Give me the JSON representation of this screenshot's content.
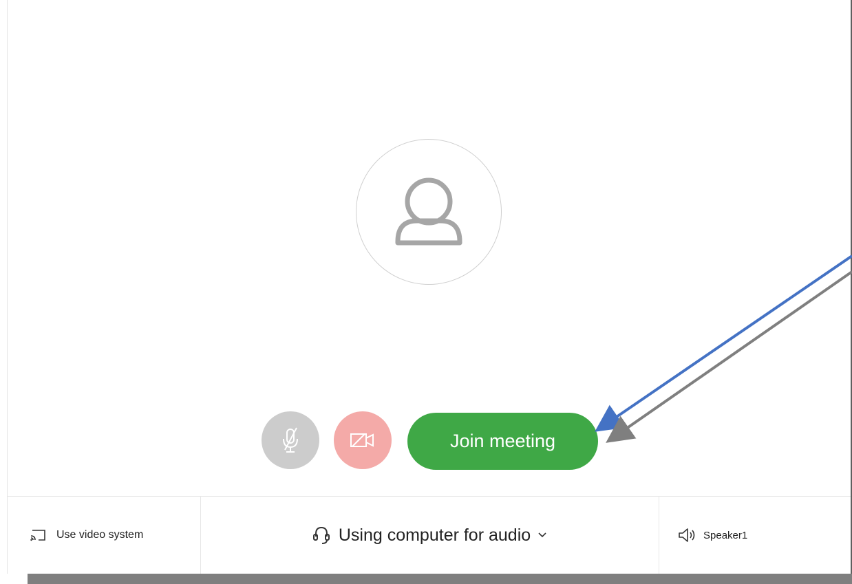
{
  "join_button": {
    "label": "Join meeting"
  },
  "footer": {
    "video_system_label": "Use video system",
    "audio_label": "Using computer for audio",
    "speaker_label": "Speaker1"
  },
  "icons": {
    "avatar": "user-avatar-icon",
    "mic": "microphone-muted-icon",
    "camera": "camera-off-icon",
    "cast": "cast-screen-icon",
    "headset": "headset-icon",
    "chevron": "chevron-down-icon",
    "speaker": "speaker-icon"
  },
  "colors": {
    "join": "#3fa846",
    "mic_bg": "#cccccc",
    "cam_bg": "#f4aaa8",
    "annotation_blue": "#4472c4",
    "annotation_gray": "#7f7f7f"
  }
}
